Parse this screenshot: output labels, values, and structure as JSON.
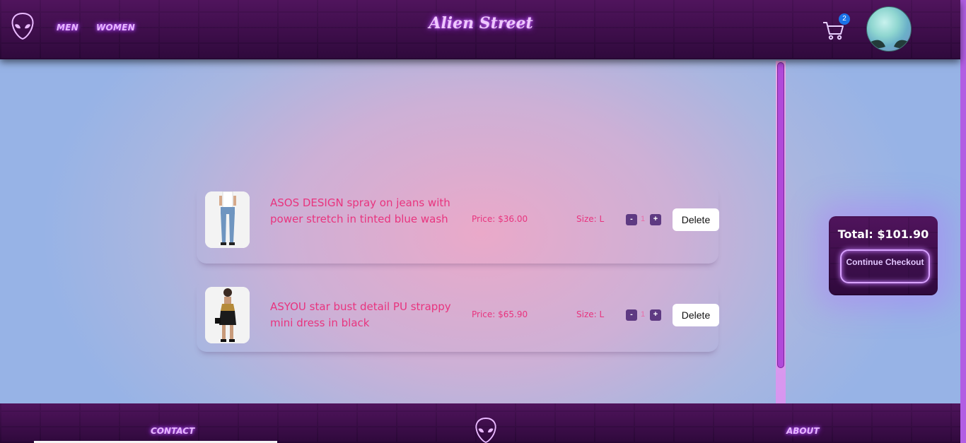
{
  "header": {
    "nav": [
      {
        "label": "MEN"
      },
      {
        "label": "WOMEN"
      }
    ],
    "brand": "Alien Street",
    "cart_count": "2",
    "icons": {
      "logo": "alien-head-icon",
      "cart": "cart-icon",
      "avatar": "alien-avatar"
    }
  },
  "cart": {
    "items": [
      {
        "name": "ASOS DESIGN spray on jeans with power stretch in tinted blue wash",
        "price": "Price: $36.00",
        "size": "Size: L",
        "qty": "1",
        "minus": "-",
        "plus": "+",
        "delete": "Delete"
      },
      {
        "name": "ASYOU star bust detail PU strappy mini dress in black",
        "price": "Price: $65.90",
        "size": "Size: L",
        "qty": "1",
        "minus": "-",
        "plus": "+",
        "delete": "Delete"
      }
    ]
  },
  "checkout": {
    "total": "Total: $101.90",
    "continue_label": "Continue Checkout"
  },
  "footer": {
    "contact": "CONTACT",
    "about": "ABOUT"
  },
  "colors": {
    "accent": "#e8347e",
    "neon": "#d9a3ff",
    "qty_button": "#5e3a82",
    "badge": "#1a73e8"
  }
}
